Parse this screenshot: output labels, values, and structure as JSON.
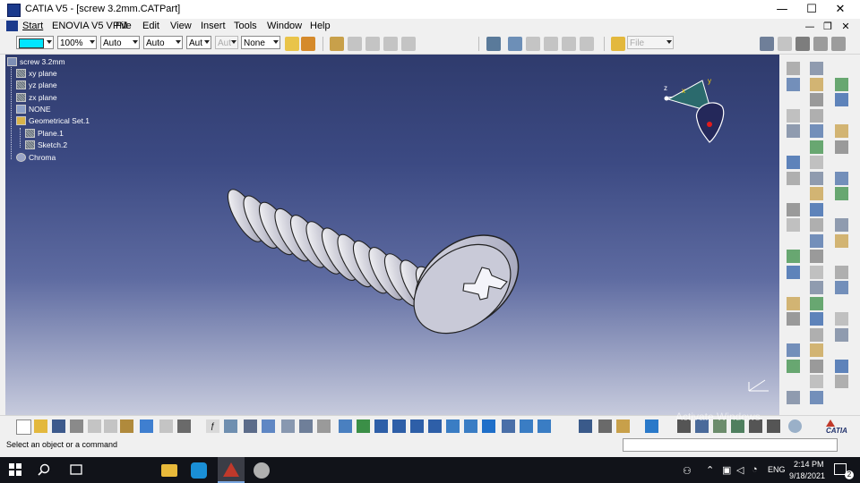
{
  "window": {
    "title": "CATIA V5 - [screw 3.2mm.CATPart]",
    "controls": [
      "—",
      "☐",
      "✕"
    ]
  },
  "menu": {
    "items": [
      "Start",
      "ENOVIA V5 VPM",
      "File",
      "Edit",
      "View",
      "Insert",
      "Tools",
      "Window",
      "Help"
    ],
    "doc_controls": [
      "—",
      "❐",
      "✕"
    ]
  },
  "toolbar": {
    "color_swatch": "#00e5ff",
    "zoom": "100%",
    "dropdown1": "Auto",
    "dropdown2": "Auto",
    "dropdown3": "Aut",
    "dropdown4": "Aut",
    "layer": "None",
    "file_dropdown": "File"
  },
  "tree": {
    "root": "screw 3.2mm",
    "items": [
      "xy plane",
      "yz plane",
      "zx plane",
      "NONE",
      "Geometrical Set.1",
      "Plane.1",
      "Sketch.2",
      "Chroma"
    ]
  },
  "compass": {
    "axis_x": "x",
    "axis_y": "y",
    "axis_z": "z"
  },
  "status": {
    "message": "Select an object or a command"
  },
  "watermark": "Activate Windows",
  "taskbar": {
    "time": "2:14 PM",
    "date": "9/18/2021",
    "lang": "ENG",
    "notif_count": "2"
  },
  "logo": "CATIA",
  "colors": {
    "viewport_top": "#2f3b6d",
    "viewport_bottom": "#c7cbdd",
    "accent_cyan": "#00e5ff"
  }
}
